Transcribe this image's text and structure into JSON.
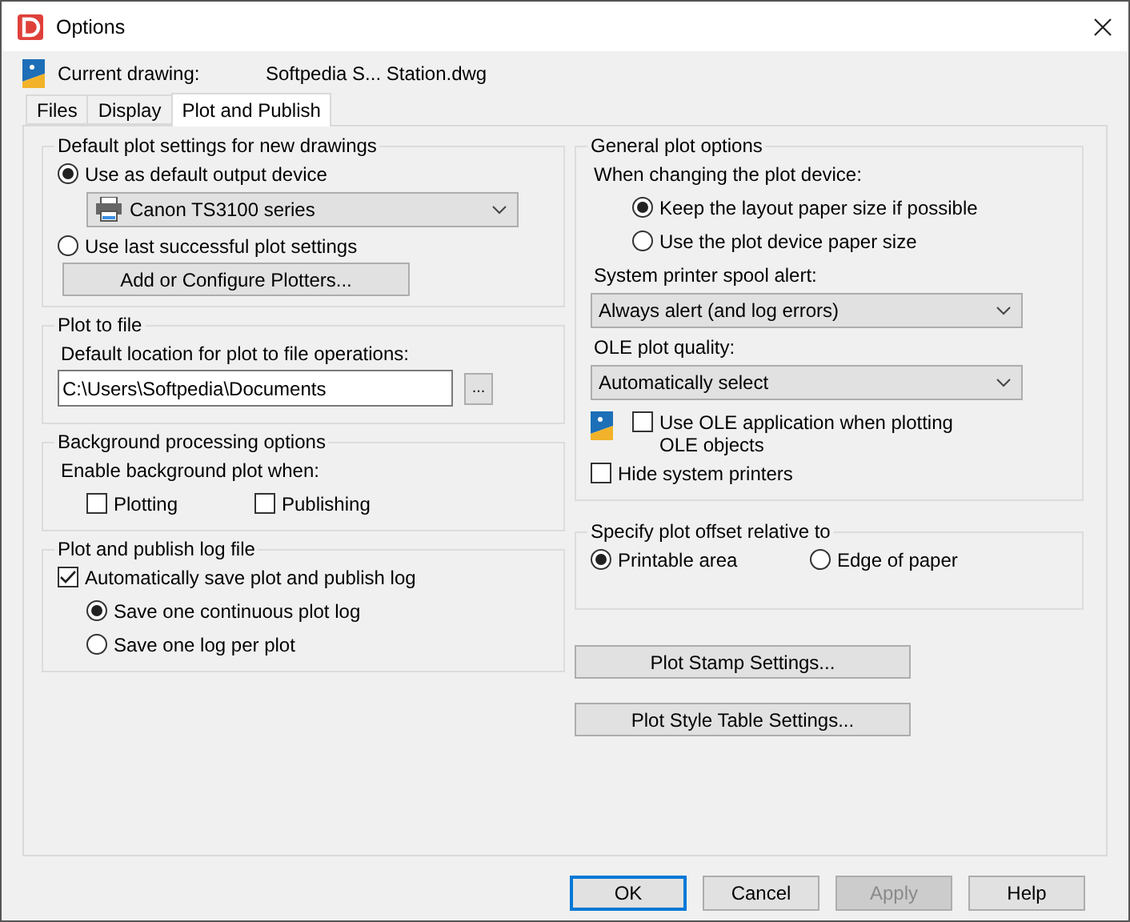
{
  "window": {
    "title": "Options"
  },
  "current_drawing": {
    "label": "Current drawing:",
    "value": "Softpedia S... Station.dwg"
  },
  "tabs": [
    {
      "label": "Files",
      "selected": false
    },
    {
      "label": "Display",
      "selected": false
    },
    {
      "label": "Plot and Publish",
      "selected": true
    }
  ],
  "left_groups": [
    {
      "title": "Default plot settings for new drawings",
      "items": [
        {
          "kind": "radio",
          "label": "Use as default output device",
          "selected": true
        },
        {
          "kind": "printer-select",
          "value": "Canon TS3100 series"
        },
        {
          "kind": "radio",
          "label": "Use last successful plot settings",
          "selected": false
        },
        {
          "kind": "button",
          "label": "Add or Configure Plotters..."
        }
      ]
    },
    {
      "title": "Plot to file",
      "items": [
        {
          "kind": "label",
          "label": "Default location for plot to file operations:"
        },
        {
          "kind": "path",
          "value": "C:\\Users\\Softpedia\\Documents",
          "browse": "..."
        }
      ]
    },
    {
      "title": "Background processing options",
      "items": [
        {
          "kind": "label",
          "label": "Enable background plot when:"
        },
        {
          "kind": "checkrow",
          "items": [
            {
              "label": "Plotting",
              "checked": false
            },
            {
              "label": "Publishing",
              "checked": false
            }
          ]
        }
      ]
    },
    {
      "title": "Plot and publish log file",
      "items": [
        {
          "kind": "checkbox",
          "label": "Automatically save plot and publish log",
          "checked": true
        },
        {
          "kind": "subradio",
          "label": "Save one continuous plot log",
          "selected": true
        },
        {
          "kind": "subradio",
          "label": "Save one log per plot",
          "selected": false
        }
      ]
    }
  ],
  "right_groups": [
    {
      "title": "General plot options",
      "items": [
        {
          "kind": "label",
          "label": "When changing the plot device:"
        },
        {
          "kind": "deepradio",
          "label": "Keep the layout paper size if possible",
          "selected": true
        },
        {
          "kind": "deepradio",
          "label": "Use the plot device paper size",
          "selected": false
        },
        {
          "kind": "label",
          "label": "System printer spool alert:"
        },
        {
          "kind": "select",
          "value": "Always alert (and log errors)"
        },
        {
          "kind": "label",
          "label": "OLE plot quality:"
        },
        {
          "kind": "select",
          "value": "Automatically select"
        },
        {
          "kind": "ole-checkbox",
          "label": "Use OLE application when plotting OLE objects",
          "checked": false
        },
        {
          "kind": "checkbox",
          "label": "Hide system printers",
          "checked": false
        }
      ]
    },
    {
      "title": "Specify plot offset relative to",
      "items": [
        {
          "kind": "radiorow",
          "items": [
            {
              "label": "Printable area",
              "selected": true
            },
            {
              "label": "Edge of paper",
              "selected": false
            }
          ]
        }
      ]
    }
  ],
  "right_buttons": [
    "Plot Stamp Settings...",
    "Plot Style Table Settings..."
  ],
  "footer_buttons": [
    {
      "label": "OK",
      "focused": true,
      "disabled": false
    },
    {
      "label": "Cancel",
      "focused": false,
      "disabled": false
    },
    {
      "label": "Apply",
      "focused": false,
      "disabled": true
    },
    {
      "label": "Help",
      "focused": false,
      "disabled": false
    }
  ]
}
